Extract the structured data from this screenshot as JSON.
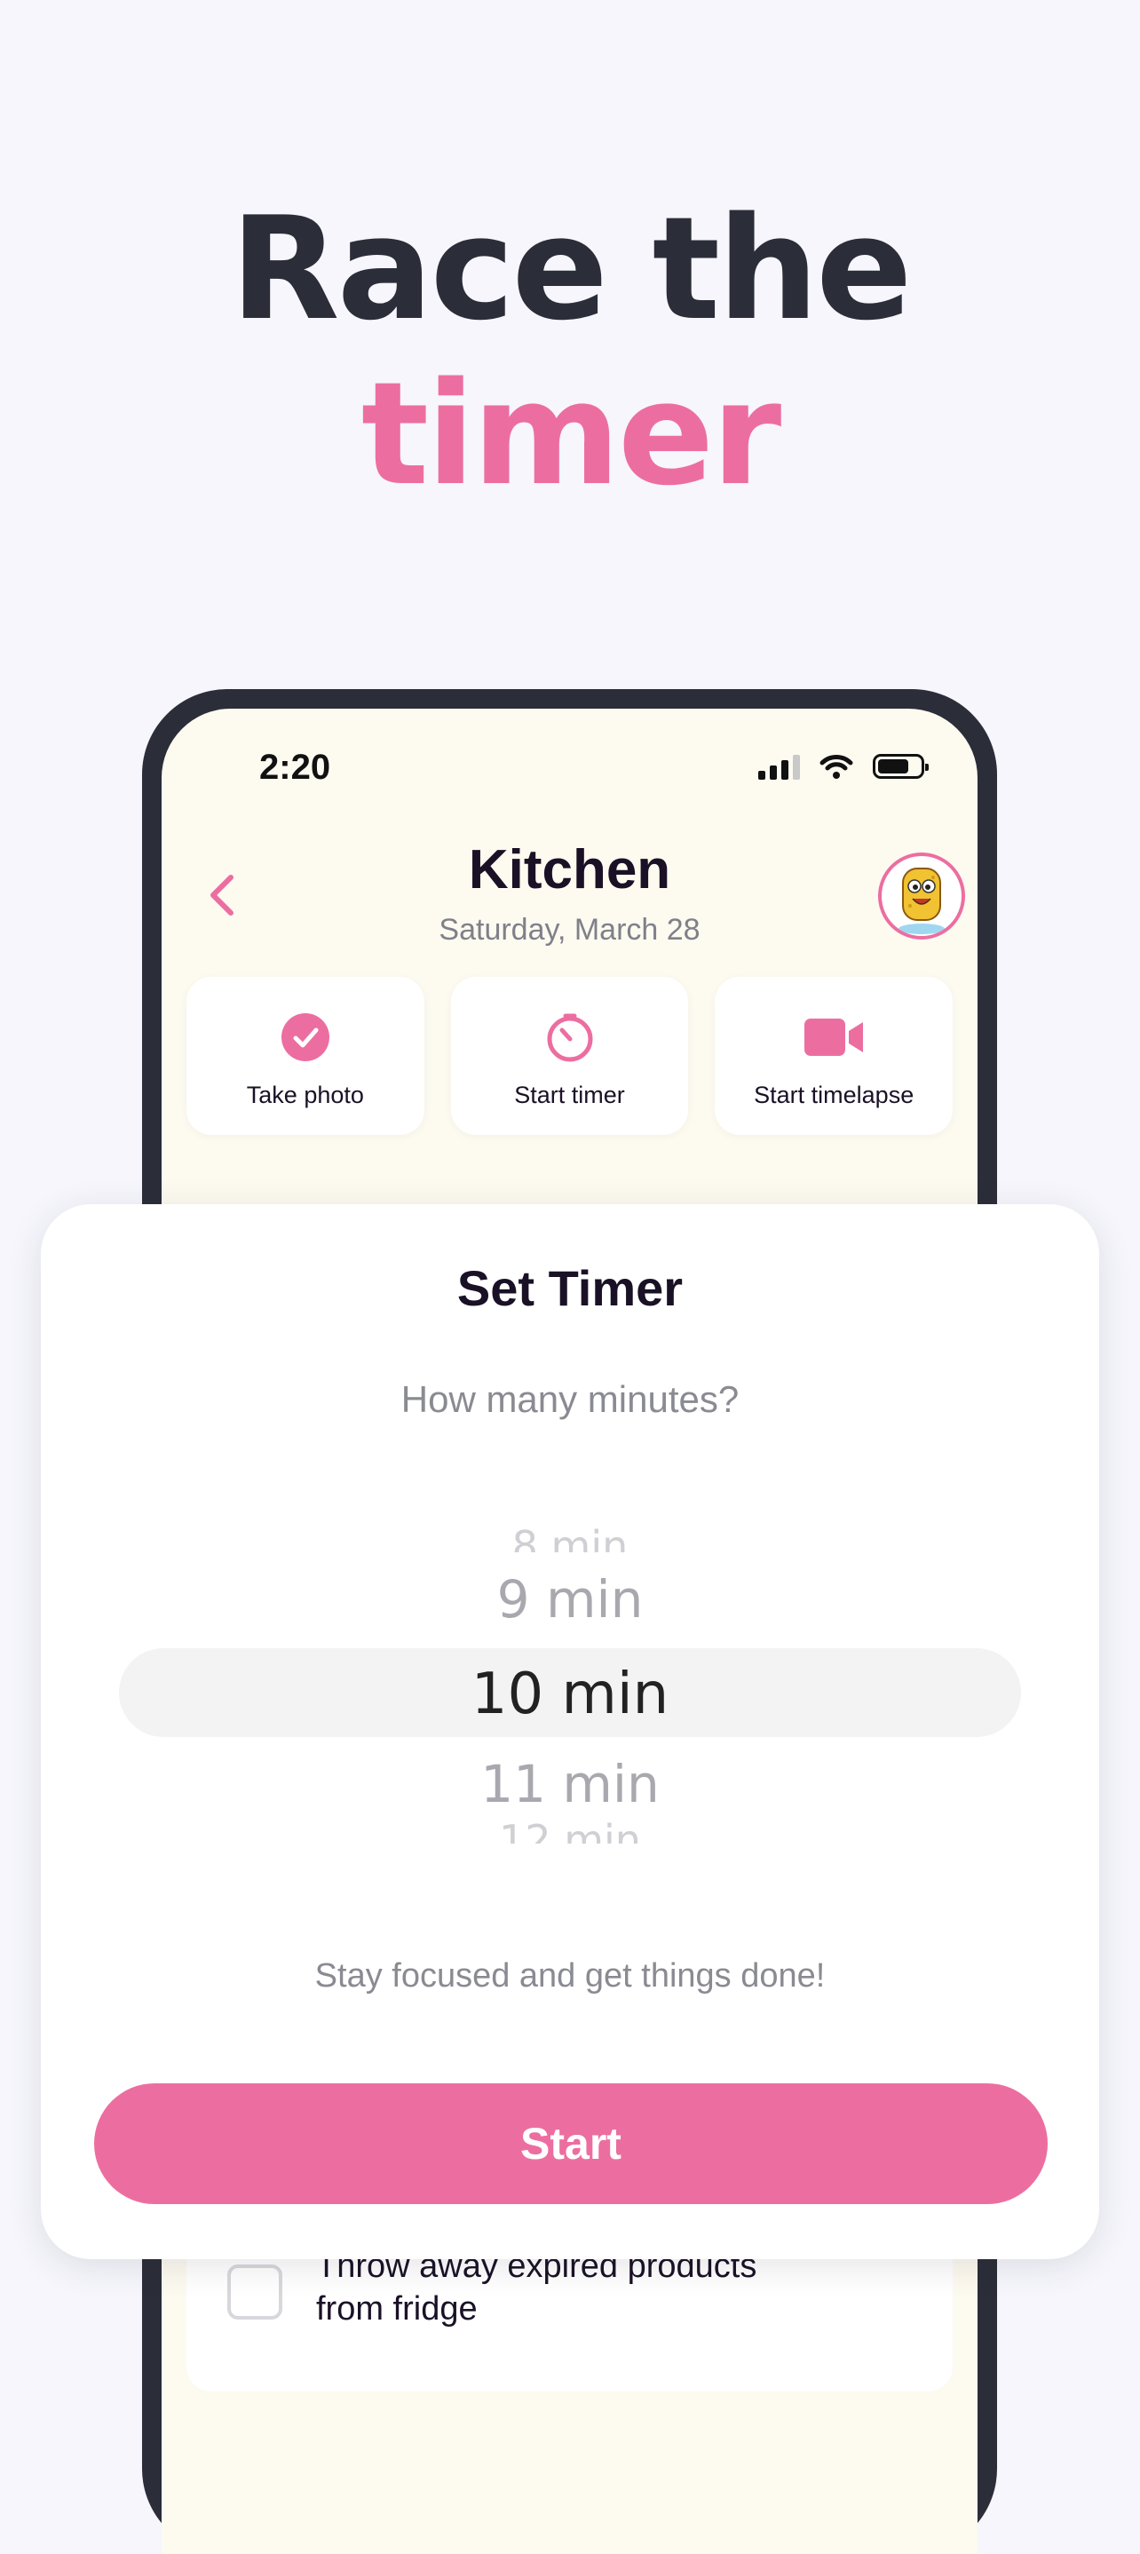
{
  "headline": {
    "line1": "Race the",
    "line2": "timer"
  },
  "status_bar": {
    "time": "2:20"
  },
  "header": {
    "title": "Kitchen",
    "date": "Saturday, March 28"
  },
  "actions": [
    {
      "label": "Take photo",
      "icon": "check-circle-icon"
    },
    {
      "label": "Start timer",
      "icon": "timer-icon"
    },
    {
      "label": "Start timelapse",
      "icon": "video-camera-icon"
    }
  ],
  "timer_sheet": {
    "title": "Set Timer",
    "subtitle": "How many minutes?",
    "options": [
      "8 min",
      "9 min",
      "10 min",
      "11 min",
      "12 min"
    ],
    "selected": "10 min",
    "motivation": "Stay focused and get things done!",
    "start_label": "Start"
  },
  "task": {
    "text": "Throw away expired products from fridge",
    "checked": false
  },
  "colors": {
    "accent": "#ec6ea0",
    "dark": "#2b2d38",
    "background": "#f6f6fc",
    "screen": "#fdfaf0"
  }
}
